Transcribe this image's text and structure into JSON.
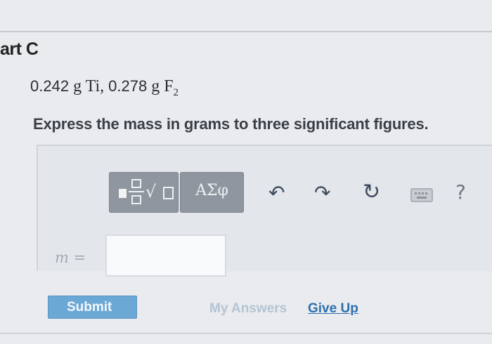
{
  "part": {
    "title": "art C"
  },
  "problem": {
    "mass1": "0.242",
    "unit1": "g",
    "element1": "Ti",
    "separator": ",",
    "mass2": "0.278",
    "unit2": "g",
    "element2": "F",
    "subscript2": "2"
  },
  "instructions": "Express the mass in grams to three significant figures.",
  "toolbar": {
    "greek_label": "ΑΣφ",
    "help_label": "?",
    "icons": [
      "templates-icon",
      "greek-symbols-icon",
      "undo-icon",
      "redo-icon",
      "reset-icon",
      "keyboard-icon",
      "help-icon"
    ]
  },
  "answer": {
    "variable_label": "m =",
    "value": ""
  },
  "actions": {
    "submit_label": "Submit",
    "my_answers_label": "My Answers",
    "give_up_label": "Give Up"
  },
  "colors": {
    "submit_bg": "#6ba8d6",
    "link": "#2d6fb0",
    "toolbar_button": "#8f969f"
  }
}
